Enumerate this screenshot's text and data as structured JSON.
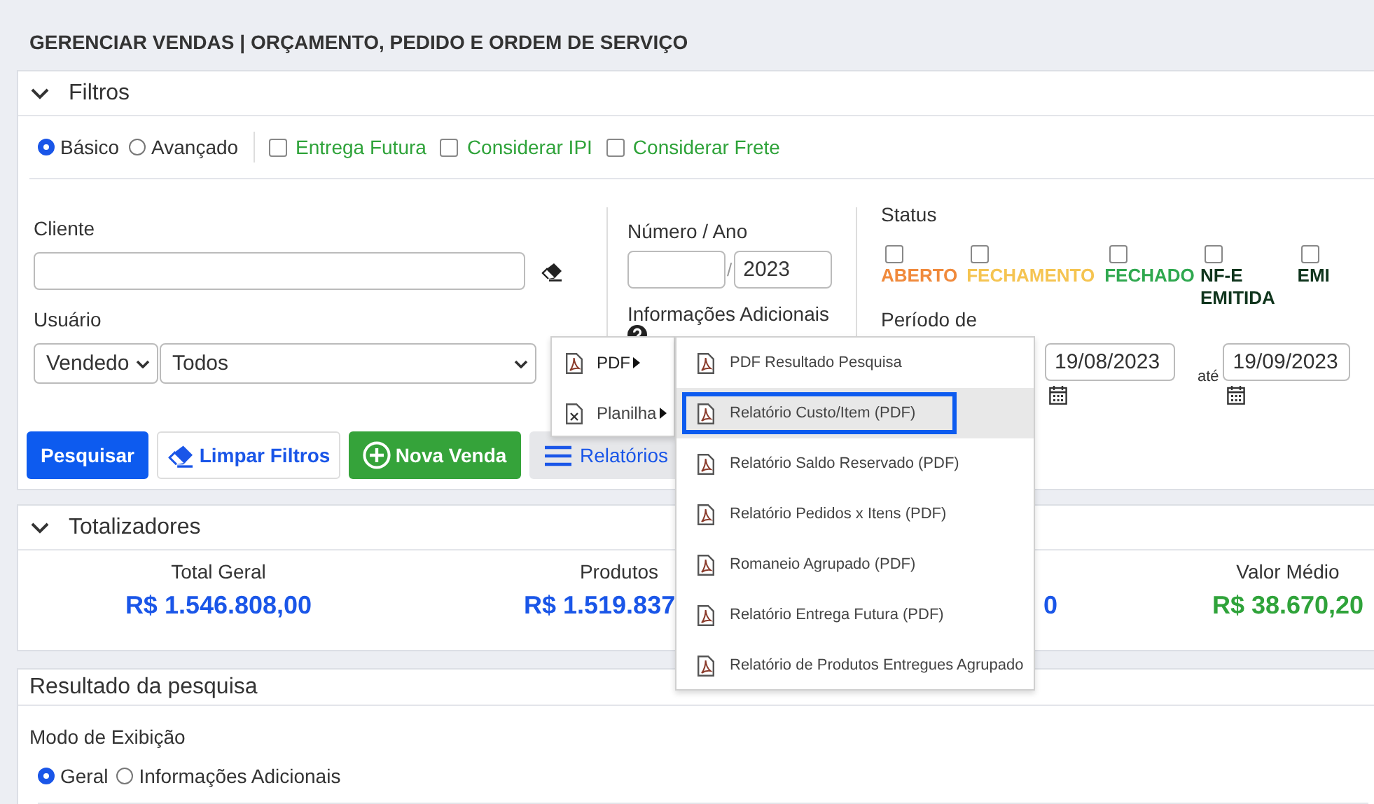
{
  "title": "GERENCIAR VENDAS | ORÇAMENTO, PEDIDO E ORDEM DE SERVIÇO",
  "filters": {
    "title": "Filtros",
    "expanded": true,
    "modes": [
      {
        "label": "Básico",
        "selected": true
      },
      {
        "label": "Avançado",
        "selected": false
      }
    ],
    "options": [
      {
        "label": "Entrega Futura",
        "checked": false
      },
      {
        "label": "Considerar IPI",
        "checked": false
      },
      {
        "label": "Considerar Frete",
        "checked": false
      }
    ],
    "cliente_label": "Cliente",
    "usuario_label": "Usuário",
    "usuario_type": "Vendedo",
    "usuario_value": "Todos",
    "numero_label": "Número / Ano",
    "numero_separator": "/",
    "ano_value": "2023",
    "info_label": "Informações Adicionais",
    "status_label": "Status",
    "status": [
      {
        "label": "ABERTO",
        "checked": false,
        "color": "#f08a3c"
      },
      {
        "label": "FECHAMENTO",
        "checked": false,
        "color": "#f5c451"
      },
      {
        "label": "FECHADO",
        "checked": false,
        "color": "#2fa84f"
      },
      {
        "label": "NF-E EMITIDA",
        "checked": false,
        "color": "#10351d"
      },
      {
        "label": "EMI",
        "checked": false,
        "color": "#10351d"
      }
    ],
    "periodo_label": "Período de",
    "date_from": "19/08/2023",
    "until_label": "até",
    "date_to": "19/09/2023",
    "buttons": [
      {
        "label": "Pesquisar",
        "kind": "primary"
      },
      {
        "label": "Limpar Filtros",
        "kind": "clear"
      },
      {
        "label": "Nova Venda",
        "kind": "new"
      },
      {
        "label": "Relatórios",
        "kind": "menu"
      }
    ]
  },
  "totals": {
    "title": "Totalizadores",
    "expanded": true,
    "items": [
      {
        "label": "Total Geral",
        "value": "R$ 1.546.808,00",
        "color": "#1a56e8"
      },
      {
        "label": "Produtos",
        "value": "R$ 1.519.837",
        "color": "#1a56e8"
      },
      {
        "value": "0",
        "color": "#1a56e8"
      },
      {
        "label": "Valor Médio",
        "value": "R$ 38.670,20",
        "color": "#2fa33a"
      }
    ]
  },
  "results": {
    "title": "Resultado da pesquisa",
    "mode_label": "Modo de Exibição",
    "modes": [
      {
        "label": "Geral",
        "selected": true
      },
      {
        "label": "Informações Adicionais",
        "selected": false
      }
    ]
  },
  "report_menu": {
    "items": [
      {
        "label": "PDF",
        "kind": "pdf",
        "selected": true
      },
      {
        "label": "Planilha",
        "kind": "sheet",
        "selected": false
      }
    ],
    "submenu": [
      {
        "label": "PDF Resultado Pesquisa",
        "selected": false
      },
      {
        "label": "Relatório Custo/Item (PDF)",
        "selected": true
      },
      {
        "label": "Relatório Saldo Reservado (PDF)",
        "selected": false
      },
      {
        "label": "Relatório Pedidos x Itens (PDF)",
        "selected": false
      },
      {
        "label": "Romaneio Agrupado (PDF)",
        "selected": false
      },
      {
        "label": "Relatório Entrega Futura (PDF)",
        "selected": false
      },
      {
        "label": "Relatório de Produtos Entregues Agrupado",
        "selected": false
      }
    ]
  }
}
